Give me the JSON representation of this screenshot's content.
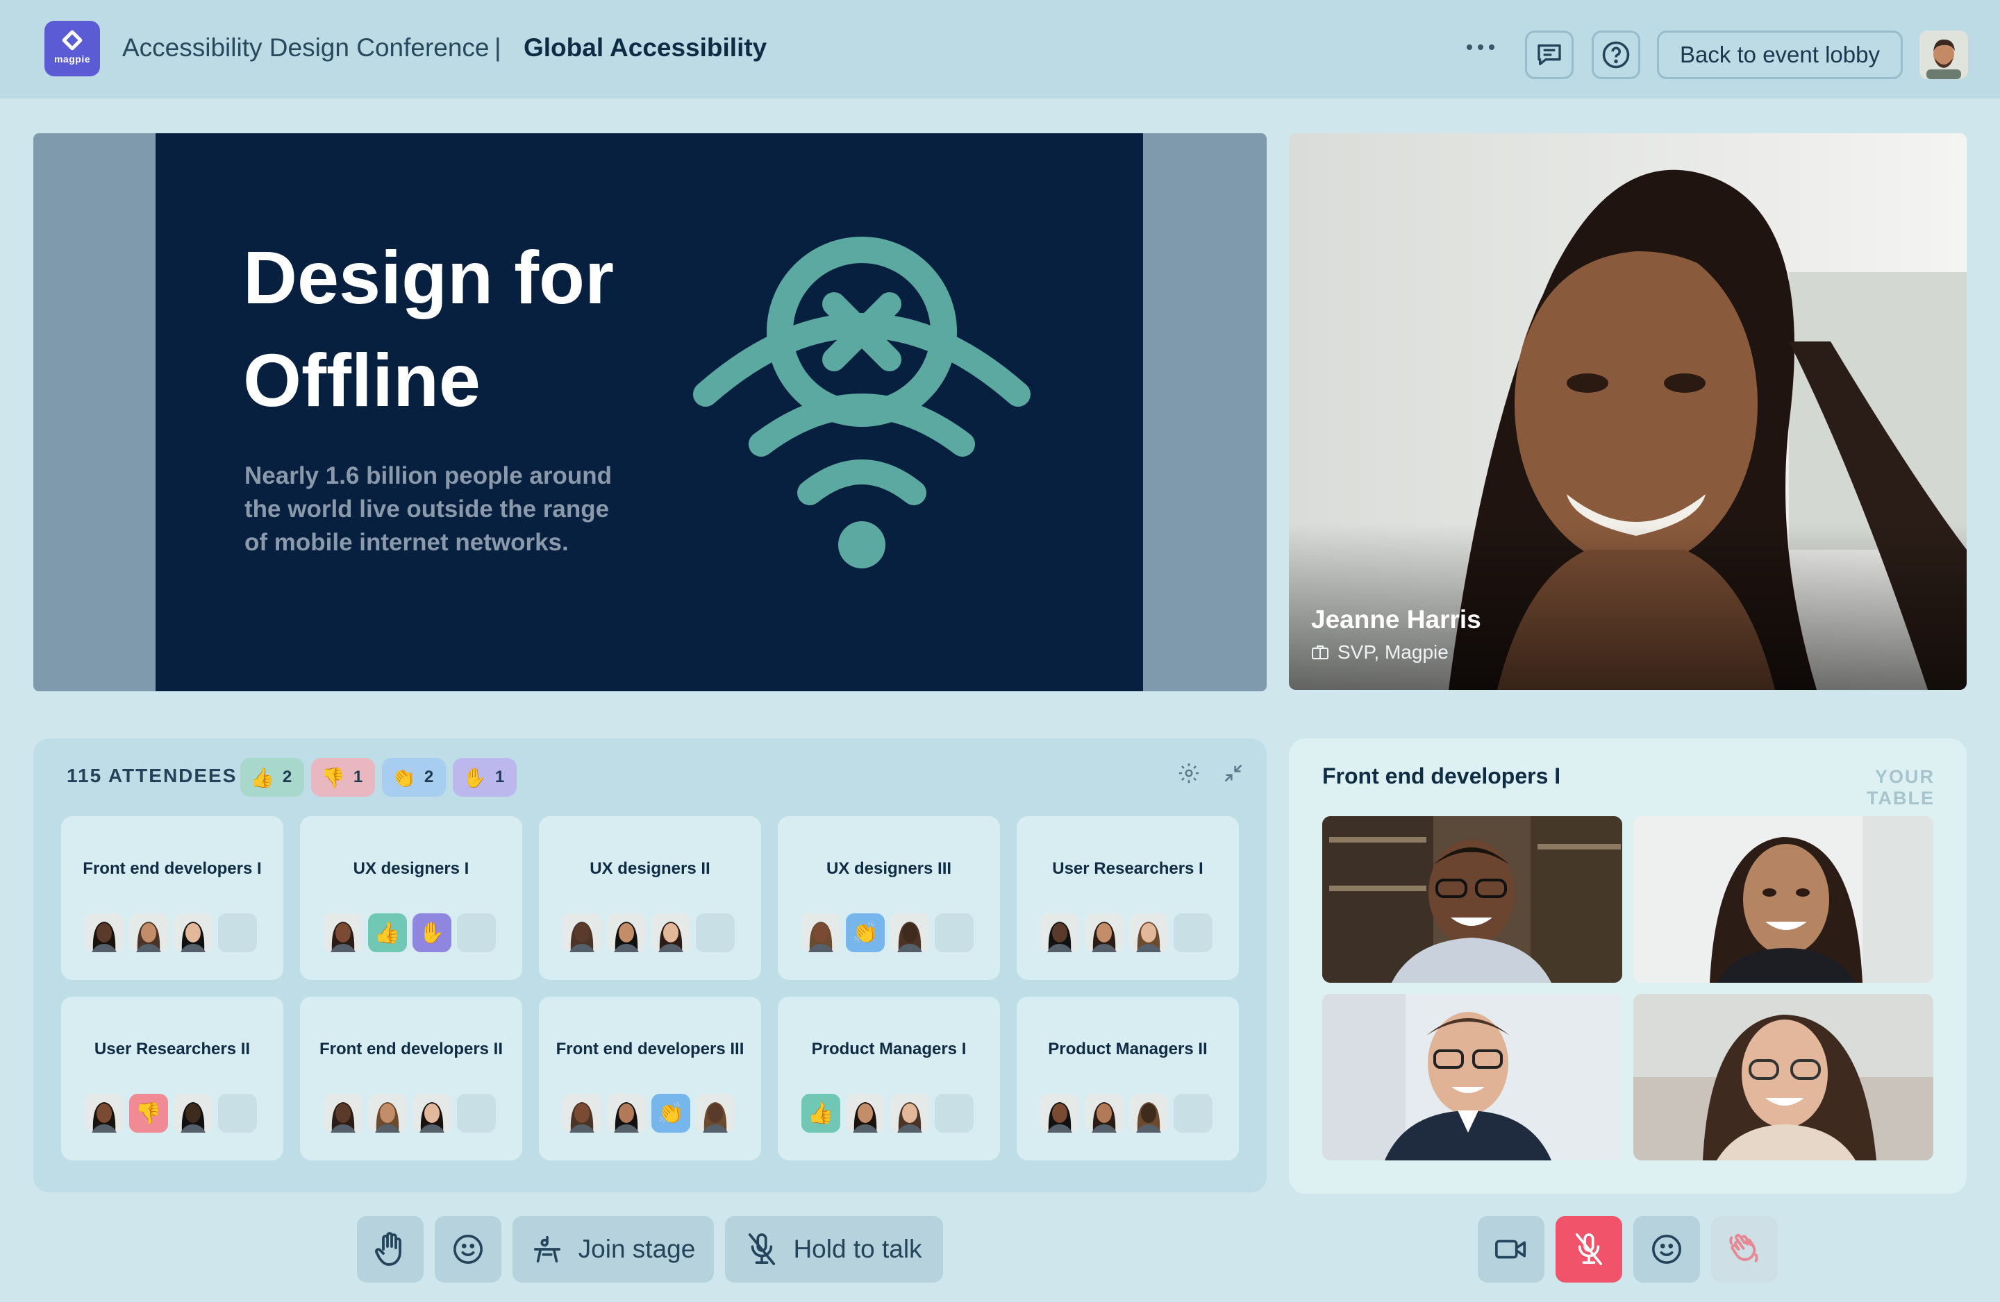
{
  "header": {
    "logo_text": "magpie",
    "conference": "Accessibility Design Conference",
    "separator": "|",
    "room": "Global Accessibility",
    "lobby_button": "Back to event lobby"
  },
  "slide": {
    "title": "Design for Offline",
    "subtitle": "Nearly 1.6 billion people around the world live outside the range of mobile internet networks."
  },
  "speaker": {
    "name": "Jeanne Harris",
    "role": "SVP, Magpie"
  },
  "attendees": {
    "label": "115 ATTENDEES",
    "reactions": [
      {
        "emoji": "👍",
        "count": "2",
        "color": "#a8d8cc"
      },
      {
        "emoji": "👎",
        "count": "1",
        "color": "#e9b7c0"
      },
      {
        "emoji": "👏",
        "count": "2",
        "color": "#a7cdf0"
      },
      {
        "emoji": "✋",
        "count": "1",
        "color": "#bcb8ee"
      }
    ]
  },
  "tables": [
    {
      "name": "Front end developers I",
      "seats": [
        "p",
        "p",
        "p",
        "e"
      ]
    },
    {
      "name": "UX designers I",
      "seats": [
        "p",
        "👍",
        "✋",
        "e"
      ]
    },
    {
      "name": "UX designers II",
      "seats": [
        "p",
        "p",
        "p",
        "e"
      ]
    },
    {
      "name": "UX designers III",
      "seats": [
        "p",
        "👏",
        "p",
        "e"
      ]
    },
    {
      "name": "User Researchers I",
      "seats": [
        "p",
        "p",
        "p",
        "e"
      ]
    },
    {
      "name": "User Researchers II",
      "seats": [
        "p",
        "👎",
        "p",
        "e"
      ]
    },
    {
      "name": "Front end developers II",
      "seats": [
        "p",
        "p",
        "p",
        "e"
      ]
    },
    {
      "name": "Front end developers III",
      "seats": [
        "p",
        "p",
        "👏",
        "p"
      ]
    },
    {
      "name": "Product Managers I",
      "seats": [
        "👍",
        "p",
        "p",
        "e"
      ]
    },
    {
      "name": "Product Managers II",
      "seats": [
        "p",
        "p",
        "p",
        "e"
      ]
    }
  ],
  "your_table": {
    "name": "Front end developers I",
    "label": "YOUR TABLE"
  },
  "bottom_bar": {
    "join_stage": "Join stage",
    "hold_to_talk": "Hold to talk"
  },
  "colors": {
    "accent": "#5b5bd6",
    "slide_bg": "#08203f",
    "slide_icon": "#5ba9a0",
    "mute_red": "#f0536a"
  },
  "icons": [
    "more-icon",
    "chat-icon",
    "help-icon",
    "hand-icon",
    "emoji-icon",
    "stage-icon",
    "mic-off-icon",
    "camera-icon",
    "wave-icon",
    "settings-icon",
    "collapse-icon",
    "briefcase-icon"
  ]
}
